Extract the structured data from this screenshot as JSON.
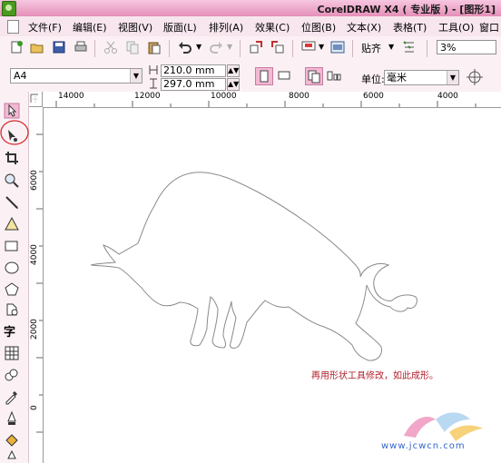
{
  "title_bar": {
    "title": "CorelDRAW X4 ( 专业版 ) - [图形1]"
  },
  "menu": {
    "items": [
      "文件(F)",
      "编辑(E)",
      "视图(V)",
      "版面(L)",
      "排列(A)",
      "效果(C)",
      "位图(B)",
      "文本(X)",
      "表格(T)",
      "工具(O)",
      "窗口"
    ]
  },
  "toolbar": {
    "icons": [
      "new-icon",
      "open-icon",
      "save-icon",
      "print-icon",
      "cut-icon",
      "copy-icon",
      "paste-icon",
      "undo-icon",
      "redo-icon",
      "import-icon",
      "export-icon",
      "app-launcher-icon",
      "welcome-screen-icon",
      "snap-to-icon",
      "options-icon"
    ],
    "align_label": "贴齐",
    "zoom": "3%"
  },
  "property_bar": {
    "page_size": "A4",
    "width": "210.0 mm",
    "height": "297.0 mm",
    "unit_label": "单位:",
    "unit": "毫米"
  },
  "rulers": {
    "horizontal_labels": [
      "14000",
      "12000",
      "10000",
      "8000",
      "6000",
      "4000"
    ],
    "vertical_labels": [
      "6000",
      "4000",
      "2000",
      "0"
    ]
  },
  "toolbox": {
    "tools": [
      "pick-tool",
      "shape-tool",
      "crop-tool",
      "zoom-tool",
      "freehand-tool",
      "smart-fill-tool",
      "rectangle-tool",
      "ellipse-tool",
      "polygon-tool",
      "basic-shapes-tool",
      "text-tool",
      "table-tool",
      "interactive-blend-tool",
      "eyedropper-tool",
      "outline-tool",
      "fill-tool"
    ],
    "text_tool_glyph": "字"
  },
  "canvas": {
    "caption": "再用形状工具修改，如此成形。",
    "watermark": "www.jcwcn.com"
  },
  "colors": {
    "title_bar": "#e58fb9",
    "caption": "#b01f2b",
    "highlight_circle": "#d62c2c",
    "outline": "#8a8a8a"
  }
}
